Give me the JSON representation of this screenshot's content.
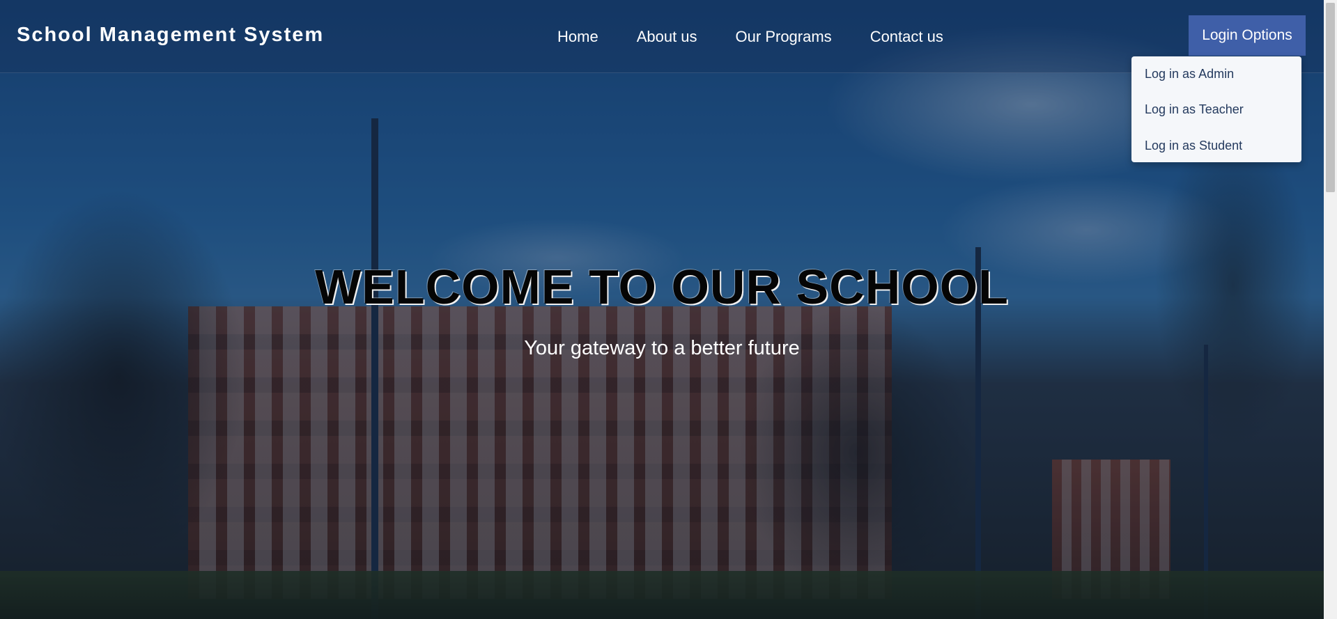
{
  "navbar": {
    "brand": "School Management System",
    "links": [
      "Home",
      "About us",
      "Our Programs",
      "Contact us"
    ],
    "login_button": "Login Options"
  },
  "dropdown": {
    "items": [
      "Log in as Admin",
      "Log in as Teacher",
      "Log in as Student"
    ]
  },
  "hero": {
    "title": "WELCOME TO OUR SCHOOL",
    "subtitle": "Your gateway to a better future"
  },
  "colors": {
    "login_button_bg": "#3f5fa8",
    "dropdown_bg": "#f5f7fa",
    "dropdown_text": "#243a5e"
  }
}
